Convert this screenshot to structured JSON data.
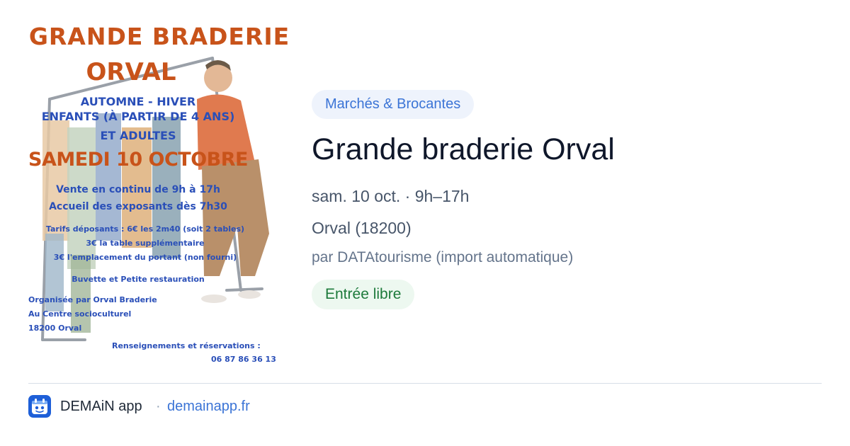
{
  "poster": {
    "line1": "GRANDE BRADERIE",
    "line2": "ORVAL",
    "line3": "AUTOMNE - HIVER",
    "line4": "ENFANTS (À PARTIR DE 4 ANS)",
    "line5": "ET ADULTES",
    "line6": "SAMEDI 10 OCTOBRE",
    "line7": "Vente en continu de 9h à 17h",
    "line8": "Accueil des exposants dès 7h30",
    "line9": "Tarifs déposants : 6€ les 2m40 (soit 2 tables)",
    "line10": "3€ la table supplémentaire",
    "line11": "3€ l'emplacement du portant (non fourni)",
    "line12": "Buvette et Petite restauration",
    "org1": "Organisée par Orval Braderie",
    "org2": "Au Centre socioculturel",
    "org3": "18200 Orval",
    "info1": "Renseignements et réservations :",
    "info2": "06 87 86 36 13"
  },
  "event": {
    "category": "Marchés & Brocantes",
    "title": "Grande braderie Orval",
    "when": "sam. 10 oct. · 9h–17h",
    "where": "Orval (18200)",
    "source": "par DATAtourisme (import automatique)",
    "price": "Entrée libre"
  },
  "footer": {
    "app_name": "DEMAiN app",
    "separator": "·",
    "site": "demainapp.fr",
    "app_icon": "demain-app-logo-icon"
  },
  "colors": {
    "accent": "#3b74d6",
    "title": "#0f172a",
    "price_text": "#1d7a3b",
    "poster_orange": "#c8531a",
    "poster_blue": "#2a4fb8"
  }
}
